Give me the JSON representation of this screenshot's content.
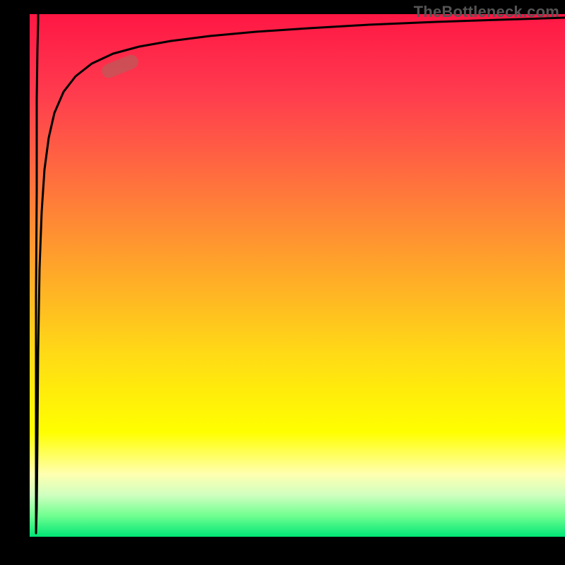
{
  "watermark": "TheBottleneck.com",
  "colors": {
    "gradient_top": "#ff1744",
    "gradient_mid": "#ffff00",
    "gradient_bottom": "#00e676",
    "curve": "#000000",
    "marker": "rgba(190,90,90,0.75)",
    "background": "#000000"
  },
  "chart_data": {
    "type": "line",
    "title": "",
    "xlabel": "",
    "ylabel": "",
    "xlim": [
      0,
      100
    ],
    "ylim": [
      0,
      100
    ],
    "grid": false,
    "legend": false,
    "annotations": [
      {
        "kind": "pill-marker",
        "x": 16,
        "y": 89,
        "angle_deg": -22
      }
    ],
    "series": [
      {
        "name": "bottleneck-curve",
        "x": [
          0.5,
          1.0,
          1.2,
          1.4,
          1.6,
          1.8,
          2.2,
          2.8,
          3.6,
          4.8,
          6.3,
          8.5,
          11.5,
          15.5,
          20,
          26,
          33,
          42,
          52,
          63,
          76,
          88,
          100
        ],
        "y": [
          100,
          0.7,
          5,
          18,
          35,
          52,
          68,
          78,
          84,
          88,
          91,
          93,
          94.5,
          95.5,
          96.3,
          97,
          97.6,
          98.1,
          98.5,
          98.8,
          99.1,
          99.3,
          99.5
        ]
      }
    ],
    "background_gradient": {
      "direction": "vertical",
      "stops": [
        {
          "pos": 0.0,
          "color": "#ff1744"
        },
        {
          "pos": 0.45,
          "color": "#ff9a2e"
        },
        {
          "pos": 0.8,
          "color": "#ffff00"
        },
        {
          "pos": 1.0,
          "color": "#00e676"
        }
      ],
      "meaning": "top is high bottleneck, bottom is low bottleneck"
    }
  }
}
